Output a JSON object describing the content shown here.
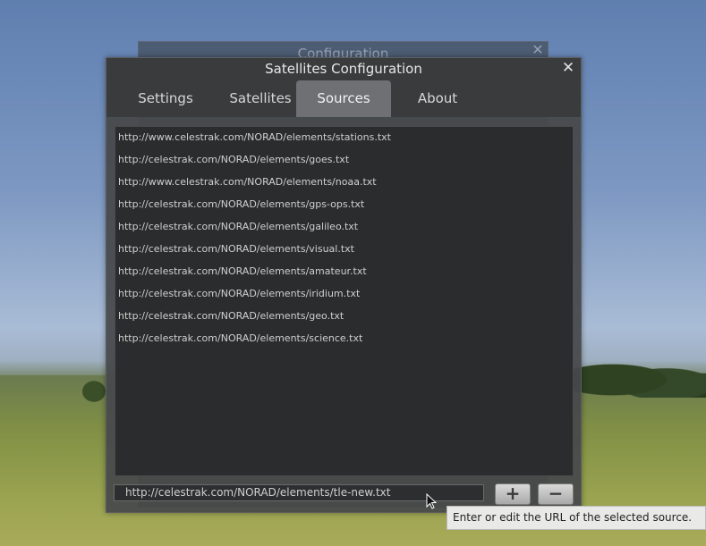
{
  "background_window": {
    "title": "Configuration",
    "close_glyph": "✕"
  },
  "dialog": {
    "title": "Satellites Configuration",
    "close_glyph": "✕",
    "tabs": [
      {
        "label": "Settings"
      },
      {
        "label": "Satellites"
      },
      {
        "label": "Sources",
        "active": true
      },
      {
        "label": "About"
      }
    ],
    "sources": [
      "http://www.celestrak.com/NORAD/elements/stations.txt",
      "http://celestrak.com/NORAD/elements/goes.txt",
      "http://www.celestrak.com/NORAD/elements/noaa.txt",
      "http://celestrak.com/NORAD/elements/gps-ops.txt",
      "http://celestrak.com/NORAD/elements/galileo.txt",
      "http://celestrak.com/NORAD/elements/visual.txt",
      "http://celestrak.com/NORAD/elements/amateur.txt",
      "http://celestrak.com/NORAD/elements/iridium.txt",
      "http://celestrak.com/NORAD/elements/geo.txt",
      "http://celestrak.com/NORAD/elements/science.txt"
    ],
    "url_input_value": "http://celestrak.com/NORAD/elements/tle-new.txt",
    "add_label": "+",
    "remove_label": "−"
  },
  "tooltip": {
    "text": "Enter or edit the URL of the selected source."
  },
  "colors": {
    "tab_active": "#6f7073",
    "dialog_bg": "#46484a",
    "list_bg": "#2b2c2d"
  }
}
